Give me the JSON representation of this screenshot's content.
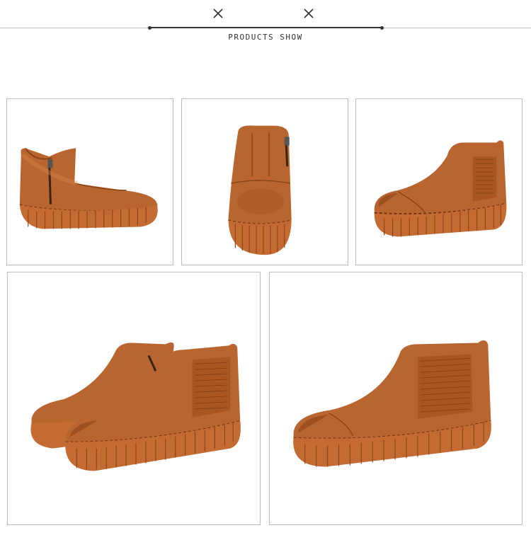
{
  "header": {
    "title": "PRODUCTS SHOW",
    "left_icon": "close-x-icon",
    "right_icon": "close-x-icon"
  },
  "gallery": {
    "items": [
      {
        "view": "side-zip"
      },
      {
        "view": "back"
      },
      {
        "view": "side-elastic"
      },
      {
        "view": "pair"
      },
      {
        "view": "front-three-quarter"
      }
    ]
  },
  "colors": {
    "leather": "#b9652f",
    "leather_dark": "#8a4517",
    "leather_light": "#d88a4e",
    "sole": "#c46a33",
    "sole_dark": "#8f4419",
    "elastic": "#a7571f",
    "rule": "#333333",
    "frame_border": "#bdbdbd"
  }
}
